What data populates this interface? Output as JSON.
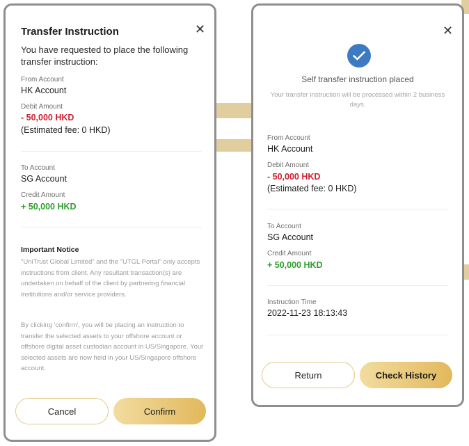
{
  "theme": {
    "accent_gold": "#e2b85c",
    "debit_color": "#d0202e",
    "credit_color": "#2f9e2c",
    "check_blue": "#3d7ac2"
  },
  "left_modal": {
    "title": "Transfer Instruction",
    "intro": "You have requested to place the following transfer instruction:",
    "from_label": "From Account",
    "from_value": "HK Account",
    "debit_label": "Debit Amount",
    "debit_value": "- 50,000 HKD",
    "fee_text": "(Estimated fee: 0 HKD)",
    "to_label": "To Account",
    "to_value": "SG Account",
    "credit_label": "Credit Amount",
    "credit_value": "+ 50,000 HKD",
    "notice_title": "Important Notice",
    "notice_p1": "\"UniTrust Global Limited\" and the \"UTGL Portal\" only accepts instructions from client. Any resultant transaction(s) are undertaken on behalf of the client by partnering financial institutions and/or service providers.",
    "notice_p2": "By clicking 'confirm', you will be placing an instruction to transfer the selected assets to your offshore account or offshore digital asset custodian account in US/Singapore. Your selected assets are now held in your US/Singapore offshore account.",
    "cancel_label": "Cancel",
    "confirm_label": "Confirm",
    "close_glyph": "✕"
  },
  "right_modal": {
    "status_title": "Self transfer instruction placed",
    "status_sub": "Your transfer instruction will be processed within 2 business days.",
    "from_label": "From Account",
    "from_value": "HK Account",
    "debit_label": "Debit Amount",
    "debit_value": "- 50,000 HKD",
    "fee_text": "(Estimated fee: 0 HKD)",
    "to_label": "To Account",
    "to_value": "SG Account",
    "credit_label": "Credit Amount",
    "credit_value": "+ 50,000 HKD",
    "time_label": "Instruction Time",
    "time_value": "2022-11-23 18:13:43",
    "return_label": "Return",
    "history_label": "Check History",
    "close_glyph": "✕"
  }
}
